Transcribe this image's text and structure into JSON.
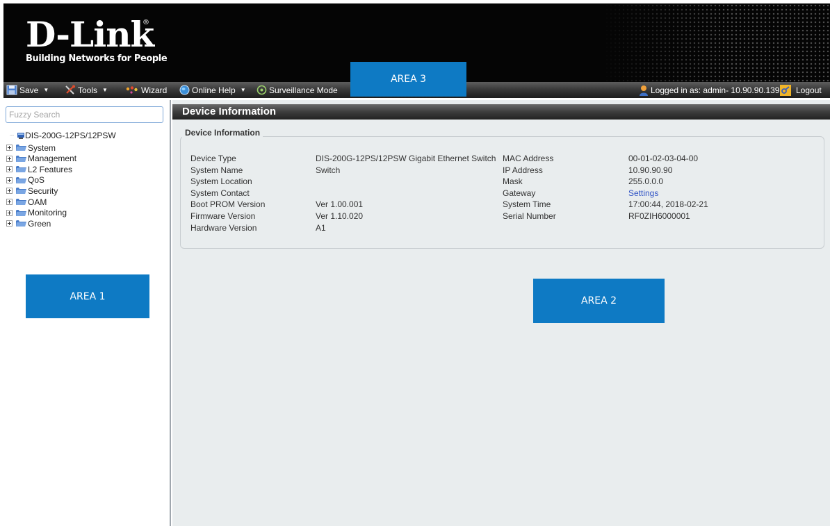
{
  "brand": {
    "name": "D-Link",
    "registered": "®",
    "tagline": "Building Networks for People"
  },
  "toolbar": {
    "save_label": "Save",
    "tools_label": "Tools",
    "wizard_label": "Wizard",
    "online_help_label": "Online Help",
    "surveillance_label": "Surveillance Mode",
    "logged_in_label": "Logged in as: admin- 10.90.90.139",
    "logout_label": "Logout"
  },
  "areas": {
    "area1": "AREA 1",
    "area2": "AREA 2",
    "area3": "AREA 3"
  },
  "sidebar": {
    "search_placeholder": "Fuzzy Search",
    "root_label": "DIS-200G-12PS/12PSW",
    "items": [
      {
        "label": "System"
      },
      {
        "label": "Management"
      },
      {
        "label": "L2 Features"
      },
      {
        "label": "QoS"
      },
      {
        "label": "Security"
      },
      {
        "label": "OAM"
      },
      {
        "label": "Monitoring"
      },
      {
        "label": "Green"
      }
    ]
  },
  "main": {
    "title": "Device Information",
    "section_legend": "Device Information",
    "left_rows": [
      {
        "label": "Device Type",
        "value": "DIS-200G-12PS/12PSW Gigabit Ethernet Switch"
      },
      {
        "label": "System Name",
        "value": "Switch"
      },
      {
        "label": "System Location",
        "value": ""
      },
      {
        "label": "System Contact",
        "value": ""
      },
      {
        "label": "Boot PROM Version",
        "value": "Ver 1.00.001"
      },
      {
        "label": "Firmware Version",
        "value": "Ver 1.10.020"
      },
      {
        "label": "Hardware Version",
        "value": "A1"
      }
    ],
    "right_rows": [
      {
        "label": "MAC Address",
        "value": "00-01-02-03-04-00"
      },
      {
        "label": "IP Address",
        "value": "10.90.90.90"
      },
      {
        "label": "Mask",
        "value": "255.0.0.0"
      },
      {
        "label": "Gateway",
        "value": "Settings"
      },
      {
        "label": "System Time",
        "value": "17:00:44, 2018-02-21"
      },
      {
        "label": "Serial Number",
        "value": "RF0ZIH6000001"
      }
    ]
  },
  "colors": {
    "area_blue": "#0e7ac4",
    "link_blue": "#2f52c5",
    "main_bg": "#e9edee"
  }
}
